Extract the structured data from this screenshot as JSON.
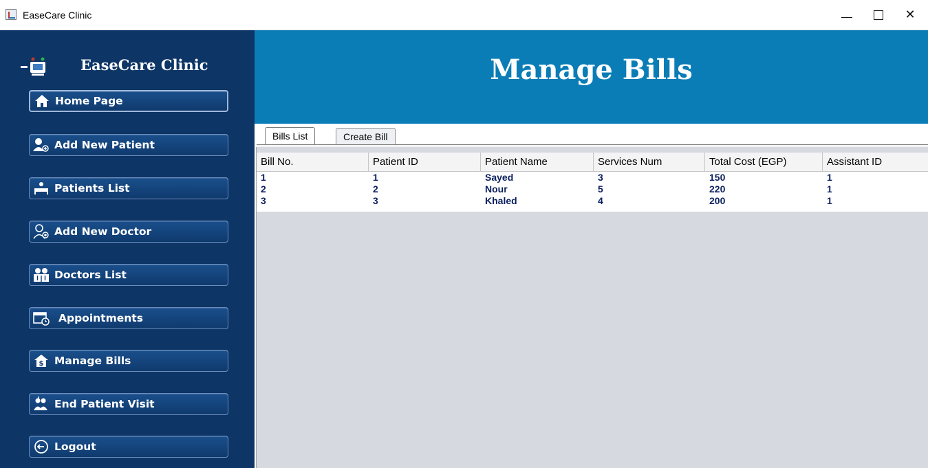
{
  "window": {
    "title": "EaseCare Clinic",
    "controls": [
      "minimize",
      "maximize",
      "close"
    ]
  },
  "sidebar": {
    "brand": "EaseCare Clinic",
    "items": [
      {
        "label": "Home Page",
        "icon": "home-icon"
      },
      {
        "label": "Add New Patient",
        "icon": "add-patient-icon"
      },
      {
        "label": "Patients List",
        "icon": "patients-list-icon"
      },
      {
        "label": "Add New Doctor",
        "icon": "add-doctor-icon"
      },
      {
        "label": "Doctors List",
        "icon": "doctors-list-icon"
      },
      {
        "label": "Appointments",
        "icon": "calendar-icon"
      },
      {
        "label": "Manage Bills",
        "icon": "bill-icon"
      },
      {
        "label": "End Patient Visit",
        "icon": "end-visit-icon"
      },
      {
        "label": "Logout",
        "icon": "logout-icon"
      }
    ]
  },
  "header": {
    "title": "Manage Bills"
  },
  "tabs": [
    {
      "label": "Bills List",
      "active": true
    },
    {
      "label": "Create Bill",
      "active": false
    }
  ],
  "table": {
    "columns": [
      "Bill No.",
      "Patient ID",
      "Patient Name",
      "Services Num",
      "Total Cost (EGP)",
      "Assistant ID"
    ],
    "rows": [
      [
        "1",
        "1",
        "Sayed",
        "3",
        "150",
        "1"
      ],
      [
        "2",
        "2",
        "Nour",
        "5",
        "220",
        "1"
      ],
      [
        "3",
        "3",
        "Khaled",
        "4",
        "200",
        "1"
      ]
    ]
  },
  "colors": {
    "sidebar_bg": "#0d3566",
    "header_bg": "#0b7db6",
    "table_text": "#0b1f5e",
    "empty_area": "#d6d9e0"
  }
}
